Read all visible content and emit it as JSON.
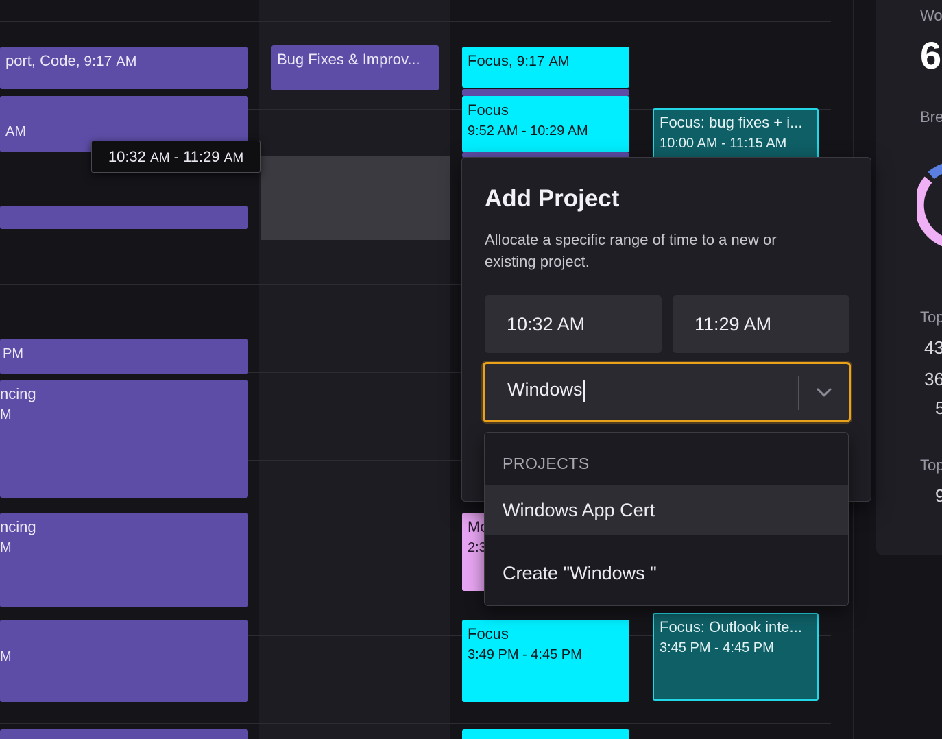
{
  "calendar": {
    "col1_events": [
      {
        "title": "port, Code",
        "time": "9:17",
        "ampm": "AM"
      },
      {
        "title": "",
        "time": "",
        "ampm": "AM"
      },
      {
        "title": "",
        "time": "",
        "ampm": "PM"
      },
      {
        "title": "ncing",
        "time": "",
        "ampm": "M"
      },
      {
        "title": "ncing",
        "time": "",
        "ampm": "M"
      },
      {
        "title": "",
        "time": "",
        "ampm": "M"
      }
    ],
    "col2_events": [
      {
        "title": "Bug Fixes & Improv..."
      }
    ],
    "col3_events": [
      {
        "title": "Focus",
        "time": "9:17",
        "ampm": "AM"
      },
      {
        "title": "Focus",
        "start": "9:52",
        "start_ampm": "AM",
        "end": "10:29",
        "end_ampm": "AM"
      },
      {
        "title": "Mo",
        "time": "2:3"
      },
      {
        "title": "Focus",
        "start": "3:49",
        "start_ampm": "PM",
        "end": "4:45",
        "end_ampm": "PM"
      }
    ],
    "col4_events": [
      {
        "title": "Focus: bug fixes + i...",
        "start": "10:00",
        "start_ampm": "AM",
        "end": "11:15",
        "end_ampm": "AM"
      },
      {
        "title": "Focus: Outlook inte...",
        "start": "3:45",
        "start_ampm": "PM",
        "end": "4:45",
        "end_ampm": "PM"
      }
    ],
    "colors": {
      "purple": "#5d4da6",
      "cyan": "#00eeff",
      "teal": "#0f5f66",
      "pink": "#e7a4f2"
    }
  },
  "tooltip": {
    "start": "10:32",
    "start_ampm": "AM",
    "sep": " - ",
    "end": "11:29",
    "end_ampm": "AM"
  },
  "right_panel": {
    "label1": "Wo",
    "big_value": "6",
    "label2": "Bre",
    "label3": "Top",
    "values": [
      "43",
      "36",
      "5"
    ],
    "label4": "Top",
    "value4": "9"
  },
  "modal": {
    "title": "Add Project",
    "description": "Allocate a specific range of time to a new or existing project.",
    "start_time": "10:32 AM",
    "end_time": "11:29 AM",
    "project_input": "Windows",
    "accent": "#eba21b"
  },
  "dropdown": {
    "header": "PROJECTS",
    "options": [
      {
        "label": "Windows App Cert"
      },
      {
        "label": "Create \"Windows \""
      }
    ]
  }
}
